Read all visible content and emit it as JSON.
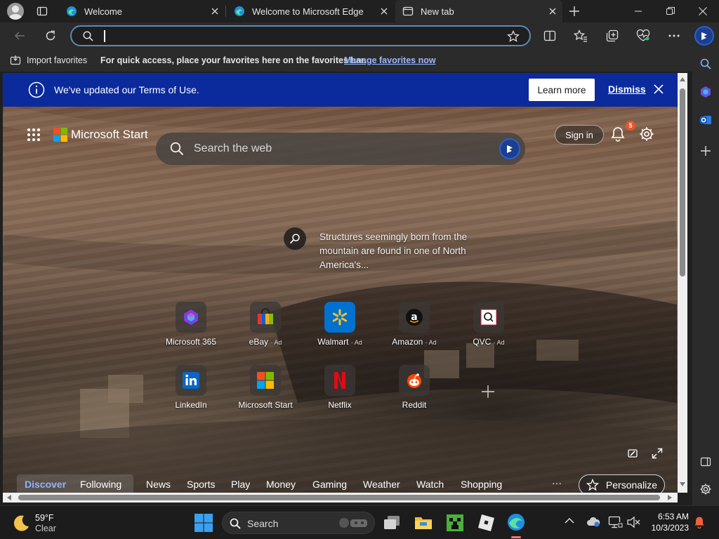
{
  "colors": {
    "accent": "#0b2a9c",
    "address_border": "#5b8ab8",
    "link": "#9ab9ff",
    "badge": "#e4572e"
  },
  "tabs": [
    {
      "title": "Welcome",
      "icon": "edge-icon"
    },
    {
      "title": "Welcome to Microsoft Edge",
      "icon": "edge-icon"
    },
    {
      "title": "New tab",
      "icon": "new-tab-icon",
      "active": true
    }
  ],
  "address_bar": {
    "value": "",
    "placeholder": ""
  },
  "favorites_bar": {
    "import_label": "Import favorites",
    "hint": "For quick access, place your favorites here on the favorites bar.",
    "manage_link": "Manage favorites now"
  },
  "banner": {
    "message": "We've updated our Terms of Use.",
    "learn_more": "Learn more",
    "dismiss": "Dismiss"
  },
  "start": {
    "brand": "Microsoft Start",
    "search_placeholder": "Search the web",
    "sign_in": "Sign in",
    "notification_count": "5",
    "caption": "Structures seemingly born from the mountain are found in one of North America's..."
  },
  "quick_links": [
    {
      "label": "Microsoft 365",
      "ad": ""
    },
    {
      "label": "eBay",
      "ad": "· Ad"
    },
    {
      "label": "Walmart",
      "ad": "· Ad"
    },
    {
      "label": "Amazon",
      "ad": "· Ad"
    },
    {
      "label": "QVC",
      "ad": "· Ad"
    },
    {
      "label": "LinkedIn",
      "ad": ""
    },
    {
      "label": "Microsoft Start",
      "ad": ""
    },
    {
      "label": "Netflix",
      "ad": ""
    },
    {
      "label": "Reddit",
      "ad": ""
    }
  ],
  "feed_tabs": [
    "Discover",
    "Following",
    "News",
    "Sports",
    "Play",
    "Money",
    "Gaming",
    "Weather",
    "Watch",
    "Shopping"
  ],
  "feed_more": "···",
  "personalize": "Personalize",
  "taskbar": {
    "weather_temp": "59°F",
    "weather_cond": "Clear",
    "search_label": "Search",
    "time": "6:53 AM",
    "date": "10/3/2023"
  }
}
